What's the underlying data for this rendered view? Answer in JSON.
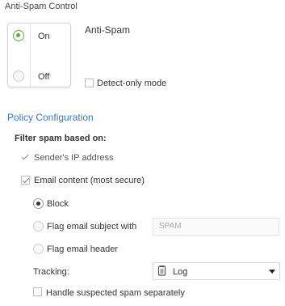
{
  "header": {
    "title": "Anti-Spam Control"
  },
  "toggle": {
    "on_label": "On",
    "off_label": "Off",
    "selected": "On"
  },
  "feature": {
    "title": "Anti-Spam",
    "detect_only_label": "Detect-only mode",
    "detect_only_checked": false
  },
  "policy": {
    "title": "Policy Configuration",
    "filter_label": "Filter spam based on:",
    "sender_ip_label": "Sender's IP address",
    "sender_ip_checked": true,
    "email_content_label": "Email content (most secure)",
    "email_content_checked": true,
    "actions": {
      "block_label": "Block",
      "flag_subject_label": "Flag email subject with",
      "flag_subject_placeholder": "SPAM",
      "flag_header_label": "Flag email header",
      "selected": "Block"
    },
    "tracking": {
      "label": "Tracking:",
      "value": "Log",
      "icon": "log-icon"
    },
    "suspected_label": "Handle suspected spam separately",
    "suspected_checked": false
  },
  "colors": {
    "accent_green": "#5bb040",
    "link_blue": "#3c78b4"
  }
}
